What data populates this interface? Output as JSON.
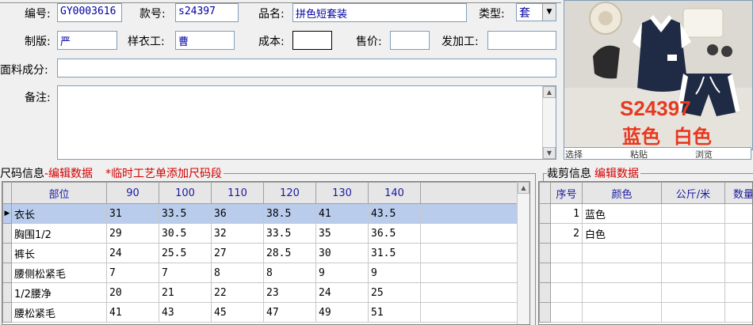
{
  "form": {
    "serial_label": "编号:",
    "serial_value": "GY0003616",
    "style_label": "款号:",
    "style_value": "s24397",
    "product_label": "品名:",
    "product_value": "拼色短套装",
    "type_label": "类型:",
    "type_value": "套",
    "plate_label": "制版:",
    "plate_value": "严",
    "sample_label": "样衣工:",
    "sample_value": "曹",
    "cost_label": "成本:",
    "cost_value": "",
    "price_label": "售价:",
    "price_value": "",
    "outsource_label": "发加工:",
    "outsource_value": "",
    "fabric_label": "面料成分:",
    "fabric_value": "",
    "remark_label": "备注:",
    "remark_value": ""
  },
  "photo": {
    "caption_code": "S24397",
    "caption_colors": "蓝色  白色",
    "select_label": "选择",
    "paste_label": "粘贴",
    "browse_label": "浏览",
    "colors": {
      "outfit": "#1f2a44",
      "caption": "#e8381e",
      "background": "#d9d6cf"
    }
  },
  "size_panel": {
    "legend_title": "尺码信息",
    "edit_link": "-编辑数据",
    "note": "*临时工艺单添加尺码段",
    "columns": [
      "部位",
      "90",
      "100",
      "110",
      "120",
      "130",
      "140"
    ],
    "rows": [
      {
        "cells": [
          "衣长",
          "31",
          "33.5",
          "36",
          "38.5",
          "41",
          "43.5"
        ],
        "selected": true
      },
      {
        "cells": [
          "胸围1/2",
          "29",
          "30.5",
          "32",
          "33.5",
          "35",
          "36.5"
        ],
        "selected": false
      },
      {
        "cells": [
          "裤长",
          "24",
          "25.5",
          "27",
          "28.5",
          "30",
          "31.5"
        ],
        "selected": false
      },
      {
        "cells": [
          "腰侧松紧毛",
          "7",
          "7",
          "8",
          "8",
          "9",
          "9"
        ],
        "selected": false
      },
      {
        "cells": [
          "1/2腰净",
          "20",
          "21",
          "22",
          "23",
          "24",
          "25"
        ],
        "selected": false
      },
      {
        "cells": [
          "腰松紧毛",
          "41",
          "43",
          "45",
          "47",
          "49",
          "51"
        ],
        "selected": false
      }
    ]
  },
  "cut_panel": {
    "legend_title": "裁剪信息",
    "edit_link": "编辑数据",
    "columns": [
      "序号",
      "颜色",
      "公斤/米",
      "数量"
    ],
    "rows": [
      {
        "cells": [
          "1",
          "蓝色",
          "",
          ""
        ]
      },
      {
        "cells": [
          "2",
          "白色",
          "",
          ""
        ]
      }
    ]
  },
  "colors": {
    "selected_row": "#b9ccec",
    "link_red": "#d40000",
    "field_text": "#0000a0"
  }
}
